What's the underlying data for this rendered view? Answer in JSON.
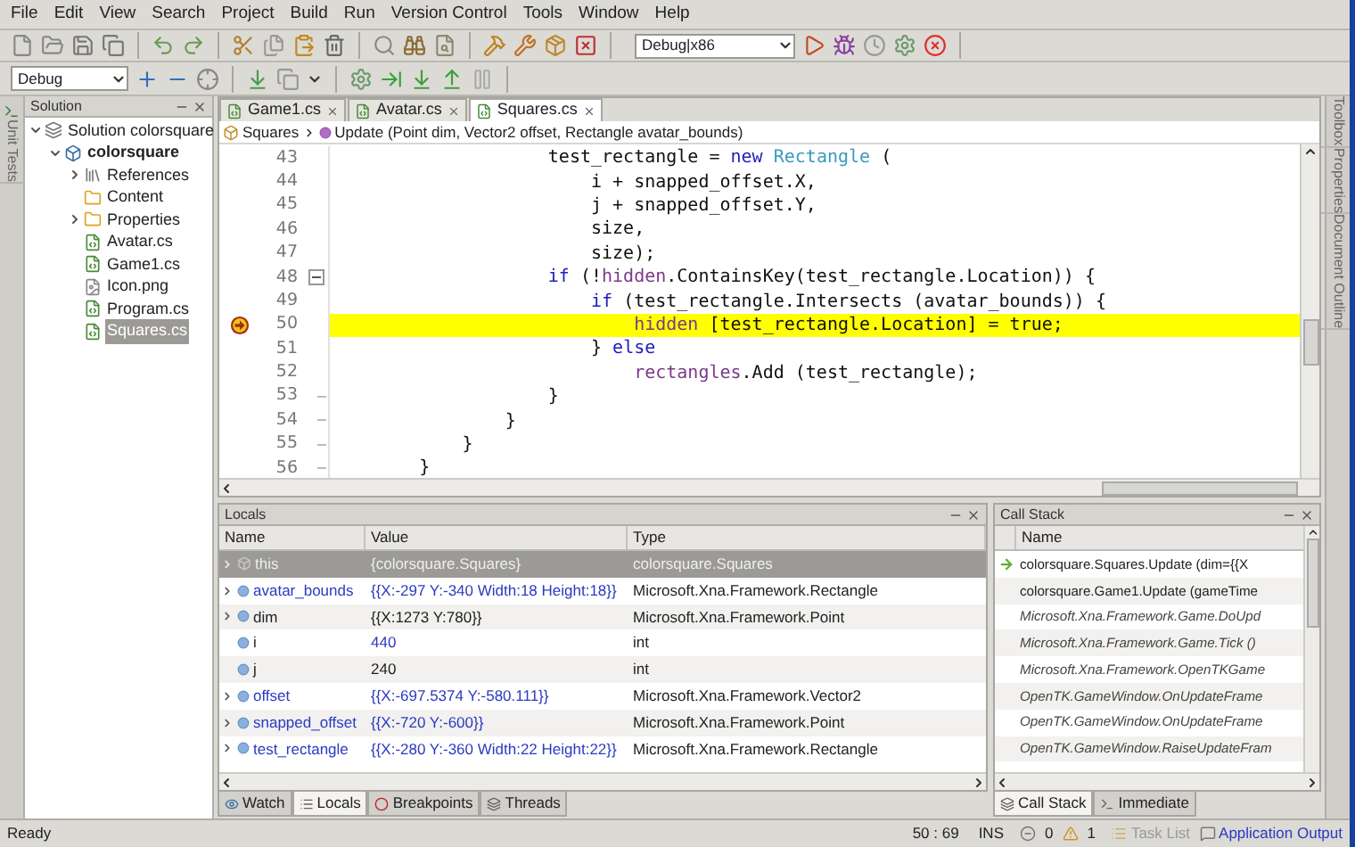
{
  "menu": [
    "File",
    "Edit",
    "View",
    "Search",
    "Project",
    "Build",
    "Run",
    "Version Control",
    "Tools",
    "Window",
    "Help"
  ],
  "toolbar": {
    "configuration": "Debug|x86"
  },
  "toolbar2": {
    "configuration": "Debug"
  },
  "left_pads": [
    {
      "label": "Unit Tests"
    }
  ],
  "right_pads": [
    {
      "label": "Toolbox"
    },
    {
      "label": "Properties"
    },
    {
      "label": "Document Outline"
    }
  ],
  "solution": {
    "title": "Solution",
    "tree": [
      {
        "label": "Solution colorsquare",
        "kind": "solution",
        "expanded": true,
        "selected": false,
        "children": [
          {
            "label": "colorsquare",
            "kind": "project",
            "expanded": true,
            "selected": false,
            "children": [
              {
                "label": "References",
                "kind": "references",
                "expanded": false,
                "selected": false
              },
              {
                "label": "Content",
                "kind": "folder",
                "selected": false
              },
              {
                "label": "Properties",
                "kind": "folder",
                "expanded": false,
                "selected": false
              },
              {
                "label": "Avatar.cs",
                "kind": "source",
                "selected": false
              },
              {
                "label": "Game1.cs",
                "kind": "source",
                "selected": false
              },
              {
                "label": "Icon.png",
                "kind": "image",
                "selected": false
              },
              {
                "label": "Program.cs",
                "kind": "source",
                "selected": false
              },
              {
                "label": "Squares.cs",
                "kind": "source",
                "selected": true
              }
            ]
          }
        ]
      }
    ]
  },
  "editor": {
    "tabs": [
      {
        "label": "Game1.cs",
        "selected": false
      },
      {
        "label": "Avatar.cs",
        "selected": false
      },
      {
        "label": "Squares.cs",
        "selected": true
      }
    ],
    "breadcrumb": {
      "class": "Squares",
      "member": "Update (Point dim, Vector2 offset, Rectangle avatar_bounds)"
    },
    "lines": [
      {
        "number": "43",
        "current": false,
        "fold_start": false,
        "fold_end": false,
        "tokens": [
          {
            "text": "                    test_rectangle = ",
            "kind": "plain"
          },
          {
            "text": "new ",
            "kind": "keyword"
          },
          {
            "text": "Rectangle",
            "kind": "type"
          },
          {
            "text": " (",
            "kind": "plain"
          }
        ]
      },
      {
        "number": "44",
        "current": false,
        "fold_start": false,
        "fold_end": false,
        "tokens": [
          {
            "text": "                        i + snapped_offset.X,",
            "kind": "plain"
          }
        ]
      },
      {
        "number": "45",
        "current": false,
        "fold_start": false,
        "fold_end": false,
        "tokens": [
          {
            "text": "                        j + snapped_offset.Y,",
            "kind": "plain"
          }
        ]
      },
      {
        "number": "46",
        "current": false,
        "fold_start": false,
        "fold_end": false,
        "tokens": [
          {
            "text": "                        size,",
            "kind": "plain"
          }
        ]
      },
      {
        "number": "47",
        "current": false,
        "fold_start": false,
        "fold_end": false,
        "tokens": [
          {
            "text": "                        size);",
            "kind": "plain"
          }
        ]
      },
      {
        "number": "48",
        "current": false,
        "fold_start": true,
        "fold_end": false,
        "tokens": [
          {
            "text": "                    if",
            "kind": "keyword"
          },
          {
            "text": " (!",
            "kind": "plain"
          },
          {
            "text": "hidden",
            "kind": "field"
          },
          {
            "text": ".ContainsKey(test_rectangle.Location)) {",
            "kind": "plain"
          }
        ]
      },
      {
        "number": "49",
        "current": false,
        "fold_start": false,
        "fold_end": false,
        "tokens": [
          {
            "text": "                        if",
            "kind": "keyword"
          },
          {
            "text": " (test_rectangle.Intersects (avatar_bounds)) {",
            "kind": "plain"
          }
        ]
      },
      {
        "number": "50",
        "current": true,
        "fold_start": false,
        "fold_end": false,
        "tokens": [
          {
            "text": "                            hidden",
            "kind": "field"
          },
          {
            "text": " [test_rectangle.Location] = true;",
            "kind": "plain"
          }
        ]
      },
      {
        "number": "51",
        "current": false,
        "fold_start": false,
        "fold_end": false,
        "tokens": [
          {
            "text": "                        } ",
            "kind": "plain"
          },
          {
            "text": "else",
            "kind": "keyword"
          }
        ]
      },
      {
        "number": "52",
        "current": false,
        "fold_start": false,
        "fold_end": false,
        "tokens": [
          {
            "text": "                            rectangles",
            "kind": "field"
          },
          {
            "text": ".Add (test_rectangle);",
            "kind": "plain"
          }
        ]
      },
      {
        "number": "53",
        "current": false,
        "fold_start": false,
        "fold_end": true,
        "tokens": [
          {
            "text": "                    }",
            "kind": "plain"
          }
        ]
      },
      {
        "number": "54",
        "current": false,
        "fold_start": false,
        "fold_end": true,
        "tokens": [
          {
            "text": "                }",
            "kind": "plain"
          }
        ]
      },
      {
        "number": "55",
        "current": false,
        "fold_start": false,
        "fold_end": true,
        "tokens": [
          {
            "text": "            }",
            "kind": "plain"
          }
        ]
      },
      {
        "number": "56",
        "current": false,
        "fold_start": false,
        "fold_end": true,
        "tokens": [
          {
            "text": "        }",
            "kind": "plain"
          }
        ]
      }
    ]
  },
  "locals": {
    "title": "Locals",
    "columns": [
      "Name",
      "Value",
      "Type"
    ],
    "rows": [
      {
        "name": "this",
        "value": "{colorsquare.Squares}",
        "type": "colorsquare.Squares",
        "kind": "object",
        "expandable": true,
        "changed": false,
        "selected": true
      },
      {
        "name": "avatar_bounds",
        "value": "{{X:-297 Y:-340 Width:18 Height:18}}",
        "type": "Microsoft.Xna.Framework.Rectangle",
        "kind": "variable",
        "expandable": true,
        "changed": true,
        "selected": false
      },
      {
        "name": "dim",
        "value": "{{X:1273 Y:780}}",
        "type": "Microsoft.Xna.Framework.Point",
        "kind": "variable",
        "expandable": true,
        "changed": false,
        "selected": false
      },
      {
        "name": "i",
        "value": "440",
        "type": "int",
        "kind": "variable",
        "expandable": false,
        "changed": true,
        "selected": false
      },
      {
        "name": "j",
        "value": "240",
        "type": "int",
        "kind": "variable",
        "expandable": false,
        "changed": false,
        "selected": false
      },
      {
        "name": "offset",
        "value": "{{X:-697.5374 Y:-580.111}}",
        "type": "Microsoft.Xna.Framework.Vector2",
        "kind": "variable",
        "expandable": true,
        "changed": true,
        "selected": false
      },
      {
        "name": "snapped_offset",
        "value": "{{X:-720 Y:-600}}",
        "type": "Microsoft.Xna.Framework.Point",
        "kind": "variable",
        "expandable": true,
        "changed": true,
        "selected": false
      },
      {
        "name": "test_rectangle",
        "value": "{{X:-280 Y:-360 Width:22 Height:22}}",
        "type": "Microsoft.Xna.Framework.Rectangle",
        "kind": "variable",
        "expandable": true,
        "changed": true,
        "selected": false
      }
    ]
  },
  "bottom_tabs": [
    {
      "label": "Watch",
      "kind": "watch",
      "selected": false
    },
    {
      "label": "Locals",
      "kind": "locals",
      "selected": true
    },
    {
      "label": "Breakpoints",
      "kind": "breakpoints",
      "selected": false
    },
    {
      "label": "Threads",
      "kind": "threads",
      "selected": false
    }
  ],
  "call_stack": {
    "title": "Call Stack",
    "columns": [
      "Name"
    ],
    "rows": [
      {
        "text": "colorsquare.Squares.Update (dim={{X",
        "current": true,
        "external": false
      },
      {
        "text": "colorsquare.Game1.Update (gameTime",
        "current": false,
        "external": false
      },
      {
        "text": "Microsoft.Xna.Framework.Game.DoUpd",
        "current": false,
        "external": true
      },
      {
        "text": "Microsoft.Xna.Framework.Game.Tick ()",
        "current": false,
        "external": true
      },
      {
        "text": "Microsoft.Xna.Framework.OpenTKGame",
        "current": false,
        "external": true
      },
      {
        "text": "OpenTK.GameWindow.OnUpdateFrame",
        "current": false,
        "external": true
      },
      {
        "text": "OpenTK.GameWindow.OnUpdateFrame",
        "current": false,
        "external": true
      },
      {
        "text": "OpenTK.GameWindow.RaiseUpdateFram",
        "current": false,
        "external": true
      }
    ]
  },
  "call_stack_tabs": [
    {
      "label": "Call Stack",
      "kind": "stack",
      "selected": true
    },
    {
      "label": "Immediate",
      "kind": "immediate",
      "selected": false
    }
  ],
  "status_bar": {
    "message": "Ready",
    "position": "50 : 69",
    "mode": "INS",
    "errors": "0",
    "warnings": "1",
    "task_list": "Task List",
    "output": "Application Output"
  }
}
